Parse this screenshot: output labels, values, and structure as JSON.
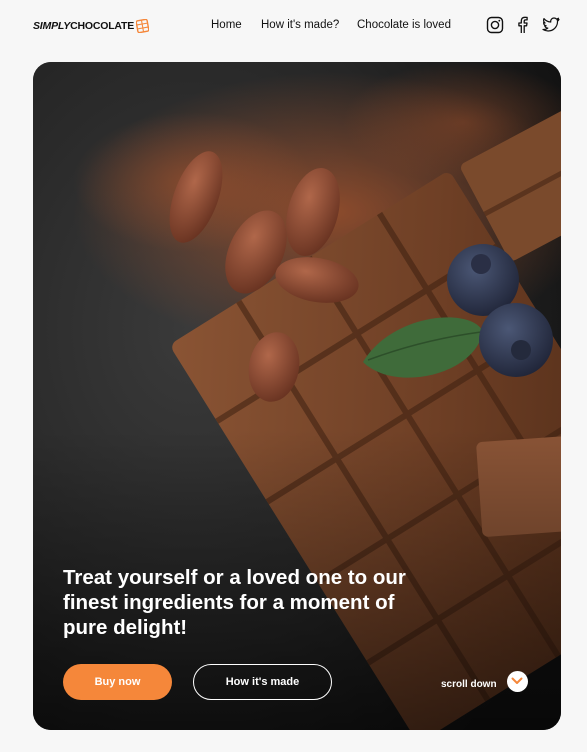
{
  "brand": {
    "simply": "SIMPLY",
    "chocolate": "CHOCOLATE"
  },
  "nav": {
    "home": "Home",
    "how": "How it's made?",
    "loved": "Chocolate is loved"
  },
  "social": [
    "instagram-icon",
    "facebook-icon",
    "twitter-icon"
  ],
  "hero": {
    "headline": "Treat yourself or a loved one to our finest ingredients for a moment of pure delight!",
    "buy_label": "Buy now",
    "how_label": "How it's made",
    "scroll_label": "scroll down"
  },
  "colors": {
    "accent": "#f5873a",
    "hero_bg": "#252525",
    "page_bg": "#f7f7f7"
  }
}
